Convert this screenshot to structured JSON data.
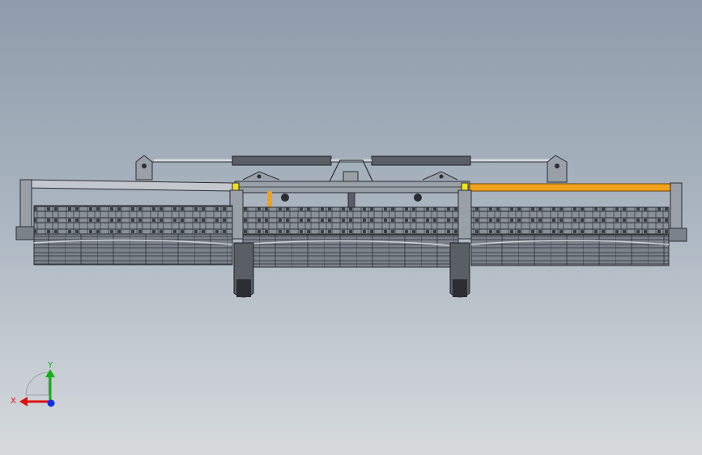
{
  "viewport": {
    "background_top": "#8e9cab",
    "background_bottom": "#d6dadd"
  },
  "model": {
    "frame_color": "#6e737a",
    "edge_color": "#2b2e33",
    "highlight_color": "#f2a21b",
    "marker_color": "#f2e21b"
  },
  "triad": {
    "x_label": "X",
    "y_label": "Y",
    "x_color": "#e01010",
    "y_color": "#10b010",
    "z_color": "#1030e0"
  }
}
